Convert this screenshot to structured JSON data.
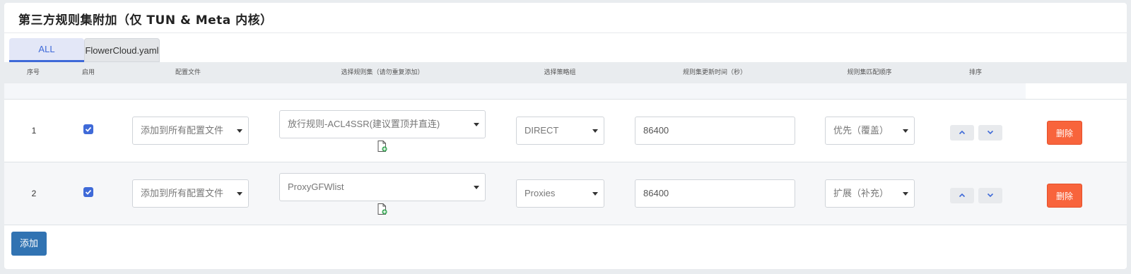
{
  "panel": {
    "title": "第三方规则集附加（仅 TUN & Meta 内核）"
  },
  "tabs": [
    {
      "label": "ALL",
      "active": true
    },
    {
      "label": "FlowerCloud.yaml",
      "active": false
    }
  ],
  "table": {
    "headers": [
      "序号",
      "启用",
      "配置文件",
      "选择规则集（请勿重复添加）",
      "选择策略组",
      "规则集更新时间（秒）",
      "规则集匹配顺序",
      "排序"
    ],
    "rows": [
      {
        "index": "1",
        "enabled": true,
        "config_file": "添加到所有配置文件",
        "rule_set": "放行规则-ACL4SSR(建议置顶并直连)",
        "policy_group": "DIRECT",
        "update_interval": "86400",
        "match_order": "优先（覆盖）",
        "delete_label": "删除"
      },
      {
        "index": "2",
        "enabled": true,
        "config_file": "添加到所有配置文件",
        "rule_set": "ProxyGFWlist",
        "policy_group": "Proxies",
        "update_interval": "86400",
        "match_order": "扩展（补充）",
        "delete_label": "删除"
      }
    ]
  },
  "add_label": "添加",
  "icons": {
    "edit_file": "file-plus-icon",
    "move_up": "chevron-up-icon",
    "move_down": "chevron-down-icon",
    "check": "check-icon"
  },
  "colors": {
    "accent": "#3f6ad8",
    "danger": "#f8643c",
    "primary": "#3173b2"
  }
}
